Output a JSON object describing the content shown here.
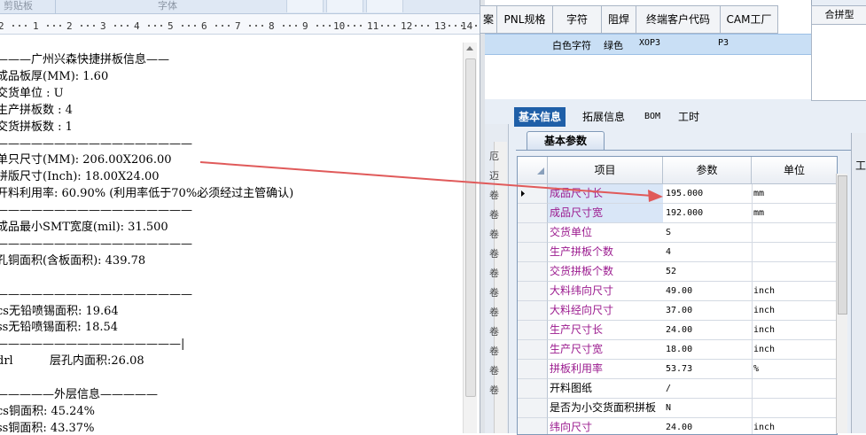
{
  "ribbon": {
    "clipboard": "剪贴板",
    "font": "字体"
  },
  "ruler": {
    "labels": [
      "2",
      "1",
      "2",
      "3",
      "4",
      "5",
      "6",
      "7",
      "8",
      "9",
      "10",
      "11",
      "12",
      "13",
      "14"
    ]
  },
  "document": {
    "lines": [
      "———广州兴森快捷拼板信息——",
      "成品板厚(MM): 1.60",
      "交货单位 : U",
      "生产拼板数 : 4",
      "交货拼板数 : 1",
      "—————————————————",
      "单只尺寸(MM): 206.00X206.00",
      "拼版尺寸(Inch): 18.00X24.00",
      "开料利用率: 60.90% (利用率低于70%必须经过主管确认)",
      "—————————————————",
      "成品最小SMT宽度(mil): 31.500",
      "—————————————————",
      "孔铜面积(含板面积): 439.78",
      "",
      "—————————————————",
      "cs无铅喷锡面积: 19.64",
      "ss无铅喷锡面积: 18.54",
      "————————————————|",
      "drl          层孔内面积:26.08",
      "",
      "—————外层信息—————",
      "cs铜面积: 45.24%",
      "ss铜面积: 43.37%"
    ]
  },
  "topgrid": {
    "headers": [
      "案",
      "PNL规格",
      "字符",
      "阻焊",
      "终端客户代码",
      "CAM工厂"
    ],
    "row": {
      "char": "白色字符",
      "mask": "绿色",
      "code": "XOP3",
      "cam": "P3"
    },
    "merge_header": "合拼型"
  },
  "tabs": [
    "基本信息",
    "拓展信息",
    "BOM",
    "工时"
  ],
  "subtab": "基本参数",
  "leftstrip_chars": [
    "厄",
    "迈",
    "卷",
    "卷",
    "卷",
    "卷",
    "卷",
    "卷",
    "卷",
    "卷",
    "卷",
    "卷",
    "卷"
  ],
  "grid": {
    "headers": {
      "item": "项目",
      "value": "参数",
      "unit": "单位"
    },
    "rows": [
      {
        "item": "成品尺寸长",
        "value": "195.000",
        "unit": "mm"
      },
      {
        "item": "成品尺寸宽",
        "value": "192.000",
        "unit": "mm"
      },
      {
        "item": "交货单位",
        "value": "S",
        "unit": ""
      },
      {
        "item": "生产拼板个数",
        "value": "4",
        "unit": ""
      },
      {
        "item": "交货拼板个数",
        "value": "52",
        "unit": ""
      },
      {
        "item": "大料纬向尺寸",
        "value": "49.00",
        "unit": "inch"
      },
      {
        "item": "大料经向尺寸",
        "value": "37.00",
        "unit": "inch"
      },
      {
        "item": "生产尺寸长",
        "value": "24.00",
        "unit": "inch"
      },
      {
        "item": "生产尺寸宽",
        "value": "18.00",
        "unit": "inch"
      },
      {
        "item": "拼板利用率",
        "value": "53.73",
        "unit": "%"
      },
      {
        "item": "开料图纸",
        "value": "/",
        "unit": ""
      },
      {
        "item": "是否为小交货面积拼板",
        "value": "N",
        "unit": ""
      },
      {
        "item": "纬向尺寸",
        "value": "24.00",
        "unit": "inch"
      }
    ]
  },
  "farright_label": "工",
  "colors": {
    "arrow": "#e05a5a",
    "tab_active": "#1f5fa8",
    "purple_text": "#9b1b8f",
    "selection": "#c9dff5"
  }
}
